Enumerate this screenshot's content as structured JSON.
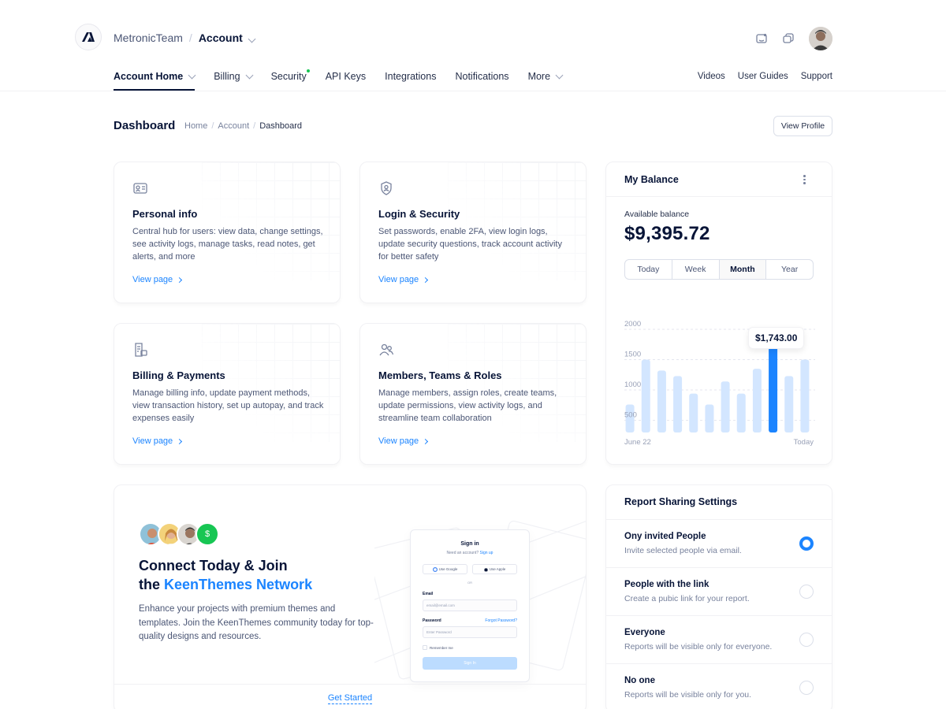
{
  "header": {
    "team": "MetronicTeam",
    "separator": "/",
    "current": "Account"
  },
  "nav": {
    "items": [
      {
        "label": "Account Home",
        "active": true,
        "dropdown": true
      },
      {
        "label": "Billing",
        "dropdown": true
      },
      {
        "label": "Security",
        "badge_dot": true
      },
      {
        "label": "API Keys"
      },
      {
        "label": "Integrations"
      },
      {
        "label": "Notifications"
      },
      {
        "label": "More",
        "dropdown": true
      }
    ],
    "right": [
      "Videos",
      "User Guides",
      "Support"
    ]
  },
  "toolbar": {
    "title": "Dashboard",
    "breadcrumb": [
      "Home",
      "Account",
      "Dashboard"
    ],
    "view_profile": "View Profile"
  },
  "cards": [
    {
      "icon": "profile-card-icon",
      "title": "Personal info",
      "desc": "Central hub for users: view data, change settings, see activity logs, manage tasks, read notes, get alerts, and more",
      "link": "View page"
    },
    {
      "icon": "shield-user-icon",
      "title": "Login & Security",
      "desc": "Set passwords, enable 2FA, view login logs, update security questions, track account activity for better safety",
      "link": "View page"
    },
    {
      "icon": "billing-icon",
      "title": "Billing & Payments",
      "desc": "Manage billing info, update payment methods, view transaction history, set up autopay, and track expenses easily",
      "link": "View page"
    },
    {
      "icon": "users-icon",
      "title": "Members, Teams & Roles",
      "desc": "Manage members, assign roles, create teams, update permissions, view activity logs, and streamline team collaboration",
      "link": "View page"
    }
  ],
  "balance": {
    "title": "My Balance",
    "available_label": "Available balance",
    "amount": "$9,395.72",
    "periods": [
      "Today",
      "Week",
      "Month",
      "Year"
    ],
    "active_period": "Month",
    "tooltip": "$1,743.00",
    "x_start": "June 22",
    "x_end": "Today"
  },
  "chart_data": {
    "type": "bar",
    "y_ticks": [
      500,
      1000,
      1500,
      2000
    ],
    "ylim": [
      300,
      2000
    ],
    "values": [
      760,
      1500,
      1320,
      1230,
      940,
      760,
      1140,
      940,
      1350,
      1743,
      1230,
      1500
    ],
    "highlight_index": 9,
    "colors": {
      "bar": "#d3e6ff",
      "highlight": "#1b84ff"
    },
    "grid": true,
    "xlabels": [
      "June 22",
      "Today"
    ]
  },
  "connect": {
    "title_line1": "Connect Today & Join",
    "title_line2_prefix": "the ",
    "title_line2_accent": "KeenThemes Network",
    "desc": "Enhance your projects with premium themes and templates. Join the KeenThemes community today for top-quality designs and resources.",
    "cta": "Get Started",
    "avatar_badge": "$",
    "preview": {
      "title": "Sign in",
      "subtitle": "Need an account?",
      "signup": "Sign up",
      "google": "Use Google",
      "apple": "Use Apple",
      "or": "OR",
      "email_label": "Email",
      "email_placeholder": "email@email.com",
      "password_label": "Password",
      "forgot": "Forgot Password?",
      "password_placeholder": "Enter Password",
      "remember": "Remember me",
      "button": "Sign In"
    }
  },
  "report": {
    "title": "Report Sharing Settings",
    "options": [
      {
        "title": "Ony invited People",
        "desc": "Invite selected people via email.",
        "selected": true
      },
      {
        "title": "People with the link",
        "desc": "Create a pubic link for your report.",
        "selected": false
      },
      {
        "title": "Everyone",
        "desc": "Reports will be visible only for everyone.",
        "selected": false
      },
      {
        "title": "No one",
        "desc": "Reports will be visible only for you.",
        "selected": false
      }
    ]
  },
  "colors": {
    "accent": "#1b84ff",
    "success": "#17c653",
    "text": "#071437",
    "muted": "#78829d"
  }
}
